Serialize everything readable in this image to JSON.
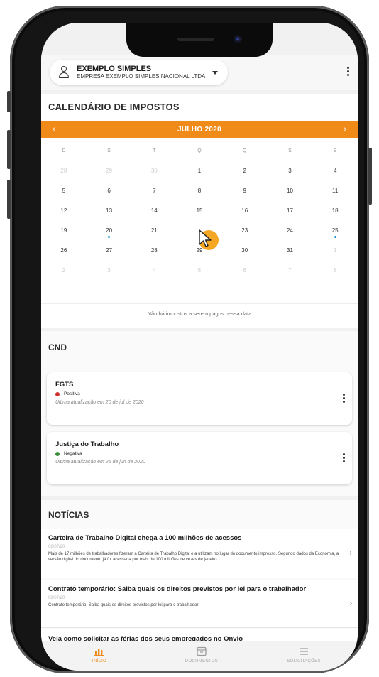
{
  "header": {
    "company_name": "EXEMPLO SIMPLES",
    "company_subtitle": "EMPRESA EXEMPLO SIMPLES NACIONAL LTDA"
  },
  "calendar": {
    "section_title": "CALENDÁRIO DE IMPOSTOS",
    "month_label": "JULHO 2020",
    "prev_arrow": "‹",
    "next_arrow": "›",
    "weekdays": [
      "D",
      "S",
      "T",
      "Q",
      "Q",
      "S",
      "S"
    ],
    "weeks": [
      [
        {
          "d": "28",
          "m": true
        },
        {
          "d": "29",
          "m": true
        },
        {
          "d": "30",
          "m": true
        },
        {
          "d": "1"
        },
        {
          "d": "2"
        },
        {
          "d": "3"
        },
        {
          "d": "4"
        }
      ],
      [
        {
          "d": "5"
        },
        {
          "d": "6"
        },
        {
          "d": "7"
        },
        {
          "d": "8"
        },
        {
          "d": "9"
        },
        {
          "d": "10"
        },
        {
          "d": "11"
        }
      ],
      [
        {
          "d": "12"
        },
        {
          "d": "13"
        },
        {
          "d": "14"
        },
        {
          "d": "15"
        },
        {
          "d": "16"
        },
        {
          "d": "17"
        },
        {
          "d": "18"
        }
      ],
      [
        {
          "d": "19"
        },
        {
          "d": "20",
          "dot": true
        },
        {
          "d": "21"
        },
        {
          "d": "22",
          "sel": true
        },
        {
          "d": "23"
        },
        {
          "d": "24"
        },
        {
          "d": "25",
          "dot": true
        }
      ],
      [
        {
          "d": "26"
        },
        {
          "d": "27"
        },
        {
          "d": "28"
        },
        {
          "d": "29"
        },
        {
          "d": "30"
        },
        {
          "d": "31"
        },
        {
          "d": "1",
          "m": true
        }
      ],
      [
        {
          "d": "2",
          "m": true
        },
        {
          "d": "3",
          "m": true
        },
        {
          "d": "4",
          "m": true
        },
        {
          "d": "5",
          "m": true
        },
        {
          "d": "6",
          "m": true
        },
        {
          "d": "7",
          "m": true
        },
        {
          "d": "8",
          "m": true
        }
      ]
    ],
    "no_tax_message": "Não há impostos a serem pagos nessa data",
    "accent_color": "#f08a18",
    "selected_color": "#f5a623",
    "due_dot_color": "#1c95d8"
  },
  "cnd": {
    "section_title": "CND",
    "cards": [
      {
        "name": "FGTS",
        "status": "Positiva",
        "status_color": "#d32f2f",
        "updated": "Última atualização em 20 de jul de 2020"
      },
      {
        "name": "Justiça do Trabalho",
        "status": "Negativa",
        "status_color": "#388e3c",
        "updated": "Última atualização em 26 de jun de 2020"
      }
    ]
  },
  "news": {
    "section_title": "NOTÍCIAS",
    "items": [
      {
        "title": "Carteira de Trabalho Digital chega a 100 milhões de acessos",
        "date": "08/07/20",
        "body": "Mais de 17 milhões de trabalhadores fizeram a Carteira de Trabalho Digital e a utilizam no lugar do documento impresso. Segundo dados da Economia, a versão digital do documento já foi acessada por mais de 100 milhões de vezes de janeiro"
      },
      {
        "title": "Contrato temporário: Saiba quais os direitos previstos por lei para o trabalhador",
        "date": "08/07/20",
        "body": "Contrato temporário: Saiba quais os direitos previstos por lei para o trabalhador"
      },
      {
        "title": "Veja como solicitar as férias dos seus empregados no Onvio",
        "date": "",
        "body": ""
      }
    ]
  },
  "bottom_nav": {
    "items": [
      {
        "label": "INÍCIO",
        "icon": "chart-icon",
        "active": true
      },
      {
        "label": "DOCUMENTOS",
        "icon": "folder-icon",
        "active": false
      },
      {
        "label": "SOLICITAÇÕES",
        "icon": "list-icon",
        "active": false
      }
    ]
  }
}
